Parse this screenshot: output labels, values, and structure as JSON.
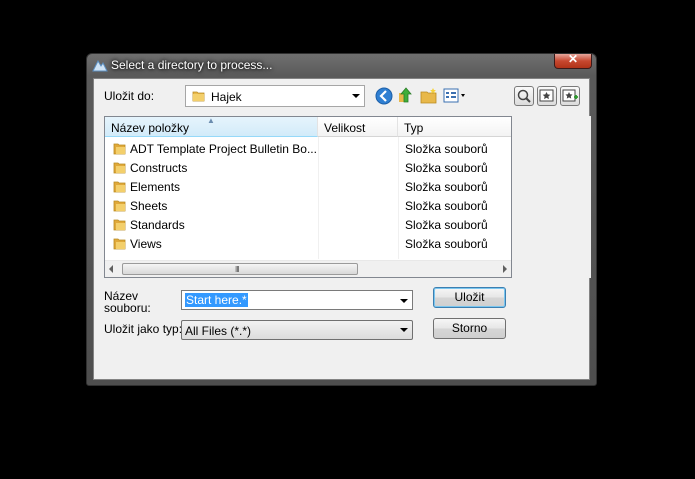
{
  "window": {
    "title": "Select a directory to process..."
  },
  "toolbar": {
    "save_in_label": "Uložit do:",
    "save_in_value": "Hajek",
    "icons": [
      "back-icon",
      "up-folder-icon",
      "new-folder-icon",
      "view-menu-icon"
    ],
    "right_icons": [
      "search-icon",
      "favorites-icon",
      "add-favorite-icon"
    ]
  },
  "list": {
    "columns": [
      "Název položky",
      "Velikost",
      "Typ"
    ],
    "rows": [
      {
        "name": "ADT Template Project Bulletin Bo...",
        "type": "Složka souborů"
      },
      {
        "name": "Constructs",
        "type": "Složka souborů"
      },
      {
        "name": "Elements",
        "type": "Složka souborů"
      },
      {
        "name": "Sheets",
        "type": "Složka souborů"
      },
      {
        "name": "Standards",
        "type": "Složka souborů"
      },
      {
        "name": "Views",
        "type": "Složka souborů"
      }
    ],
    "scroll_grip": "III"
  },
  "form": {
    "filename_label_1": "Název",
    "filename_label_2": "souboru:",
    "filename_value": "Start here.*",
    "filetype_label": "Uložit jako typ:",
    "filetype_value": "All Files (*.*)"
  },
  "buttons": {
    "save": "Uložit",
    "cancel": "Storno"
  },
  "colors": {
    "selection": "#3399ff",
    "folder": "#e8b84a",
    "close": "#c7472f"
  }
}
